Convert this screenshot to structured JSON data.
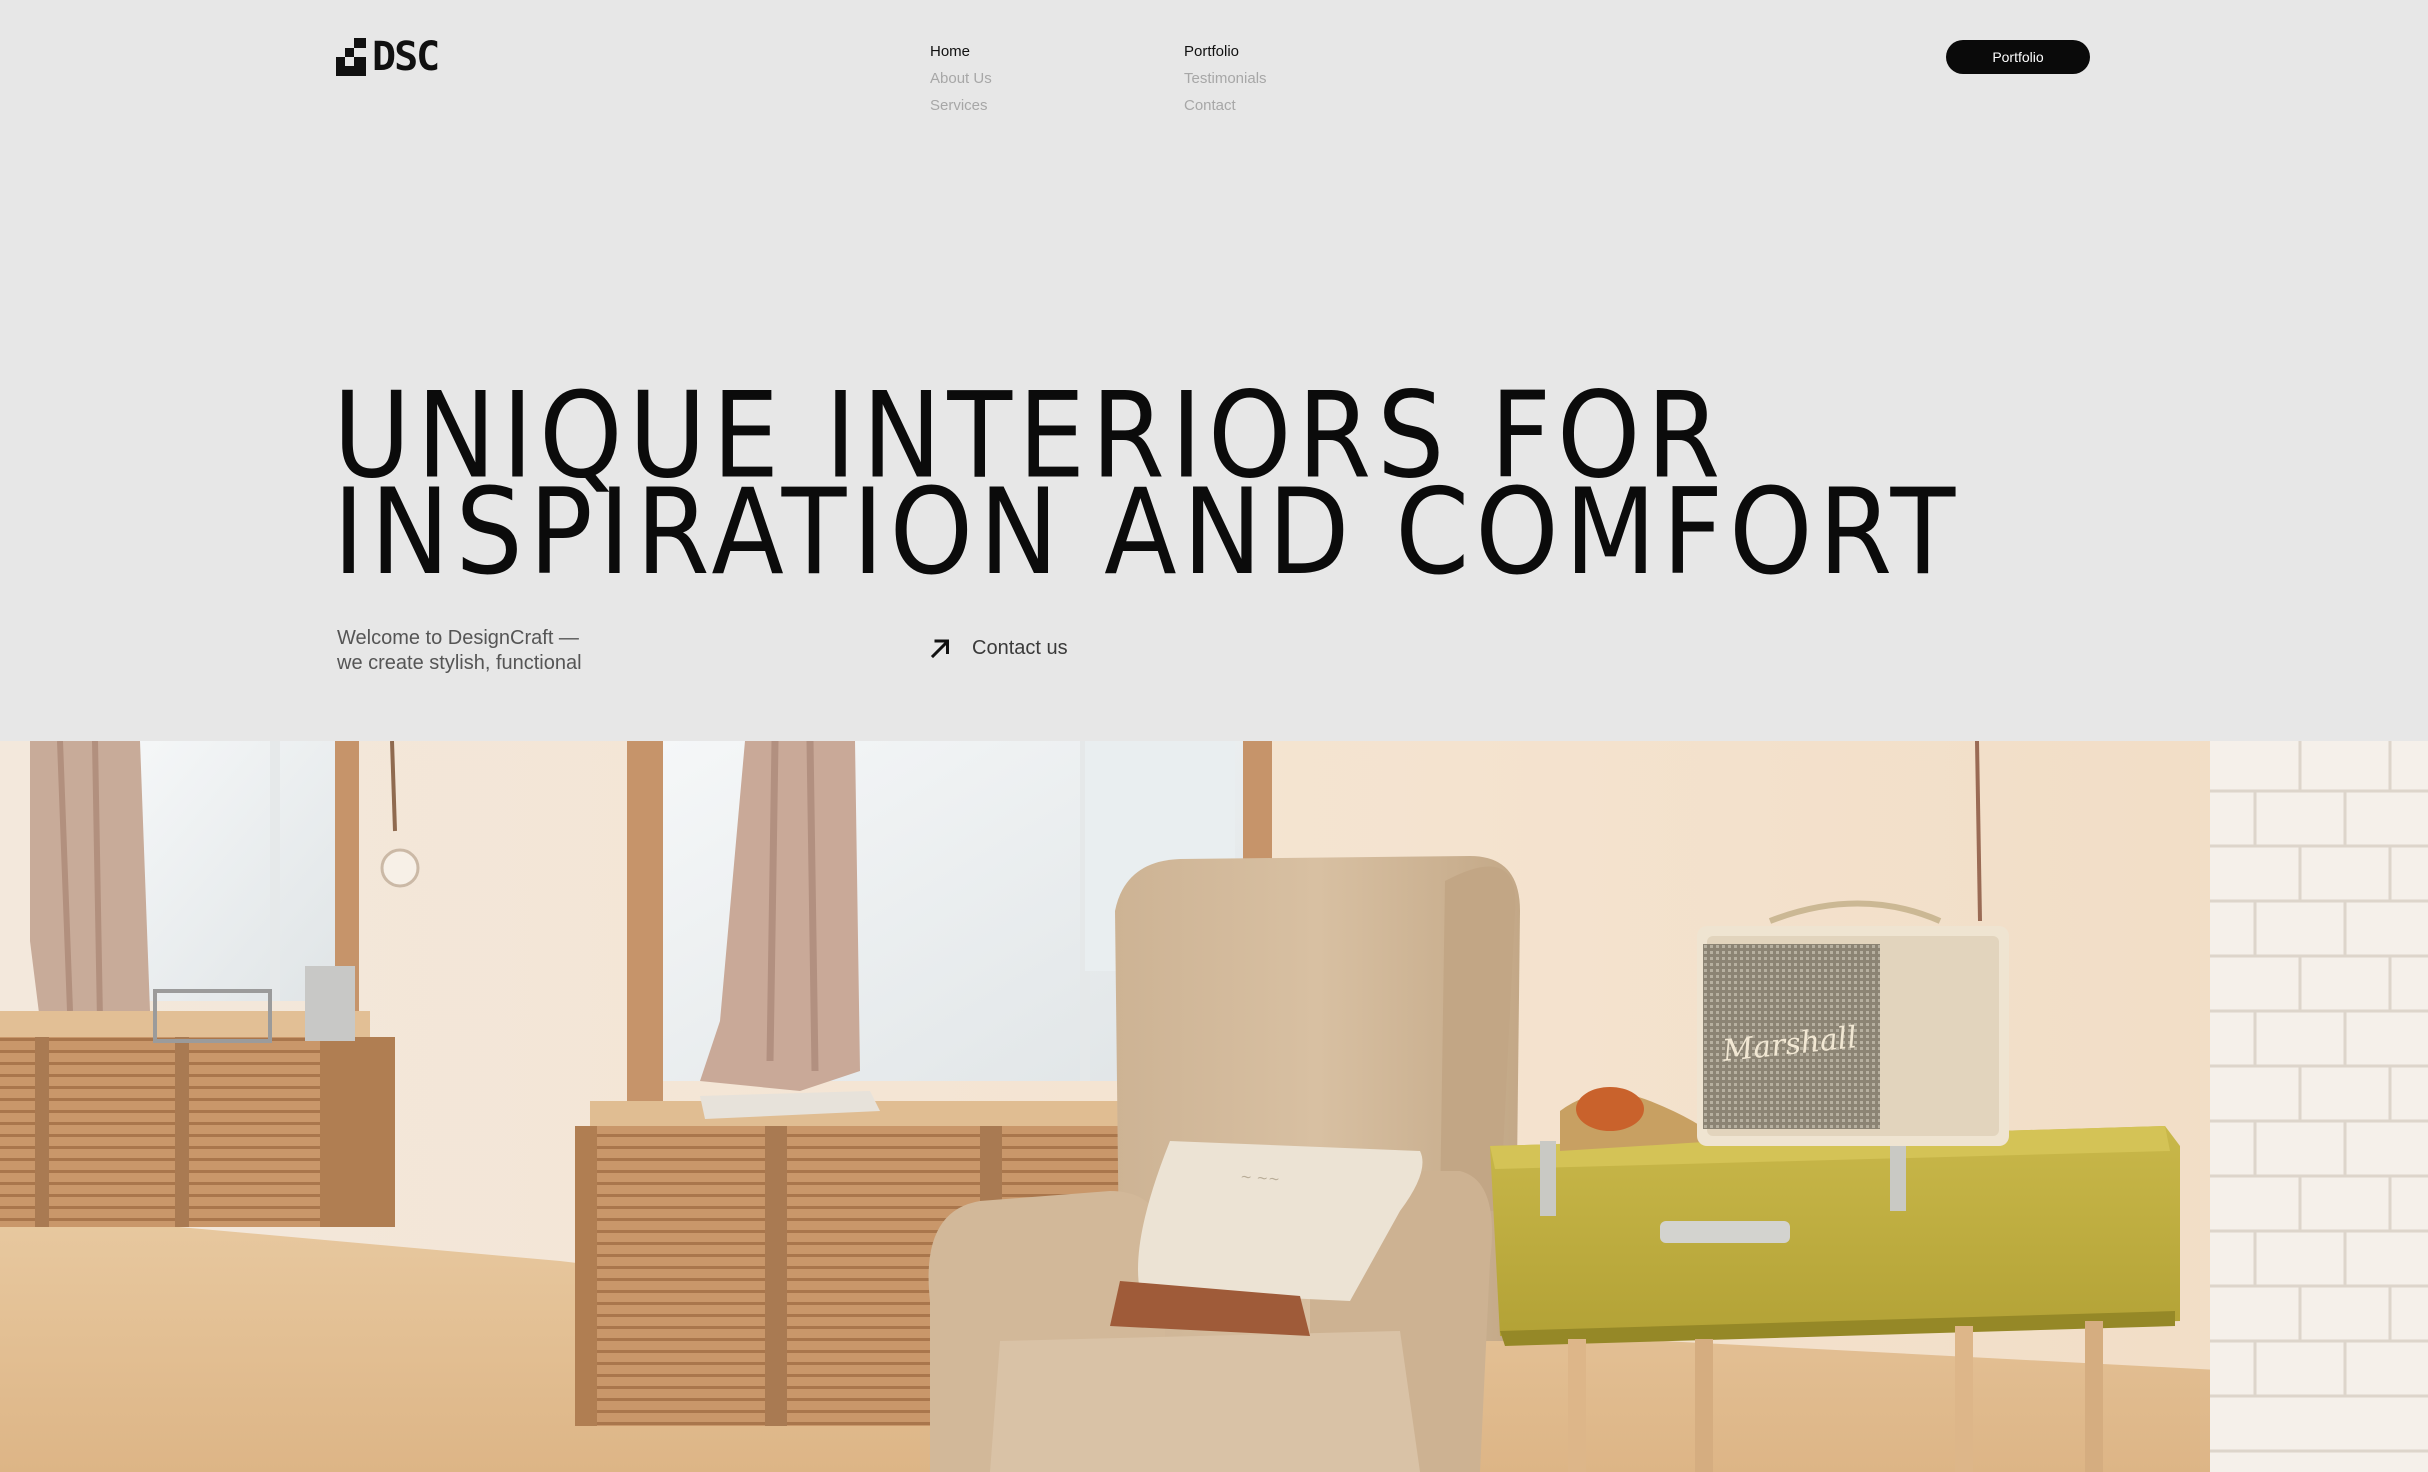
{
  "brand": {
    "logo_text": "DSC"
  },
  "nav": {
    "column_1": [
      {
        "label": "Home"
      },
      {
        "label": "About Us"
      },
      {
        "label": "Services"
      }
    ],
    "column_2": [
      {
        "label": "Portfolio"
      },
      {
        "label": "Testimonials"
      },
      {
        "label": "Contact"
      }
    ]
  },
  "header": {
    "cta_label": "Portfolio"
  },
  "hero": {
    "title_line_1": "UNIQUE INTERIORS FOR",
    "title_line_2": "INSPIRATION AND COMFORT",
    "intro_line_1": "Welcome to DesignCraft —",
    "intro_line_2": "we create stylish, functional",
    "contact_label": "Contact us"
  },
  "photo": {
    "speaker_brand": "Marshall"
  },
  "colors": {
    "background": "#e7e7e7",
    "text": "#111111",
    "muted_nav": "#a7a7a7",
    "button": "#0a0a0a"
  }
}
